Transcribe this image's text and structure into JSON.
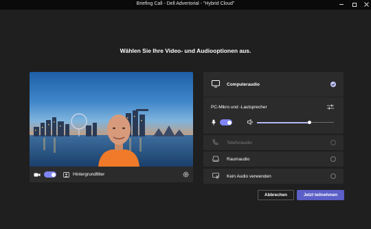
{
  "window": {
    "title": "Briefing Call - Dell Advertorial - \"Hybrid Cloud\""
  },
  "heading": "Wählen Sie Ihre Video- und Audiooptionen aus.",
  "video": {
    "background_filter_label": "Hintergrundfilter",
    "camera_on": true
  },
  "audio": {
    "computer_audio_label": "Computeraudio",
    "device_label": "PC-Mikro und -Lautsprecher",
    "mic_on": true,
    "volume_level": 0.68,
    "phone_audio_label": "Telefonaudio",
    "room_audio_label": "Raumaudio",
    "no_audio_label": "Kein Audio verwenden"
  },
  "buttons": {
    "cancel_label": "Abbrechen",
    "join_label": "Jetzt teilnehmen"
  },
  "colors": {
    "accent": "#5b5fc7",
    "toggle": "#7f85f5",
    "background": "#1f1f1f",
    "panel": "#2b2b2b"
  }
}
